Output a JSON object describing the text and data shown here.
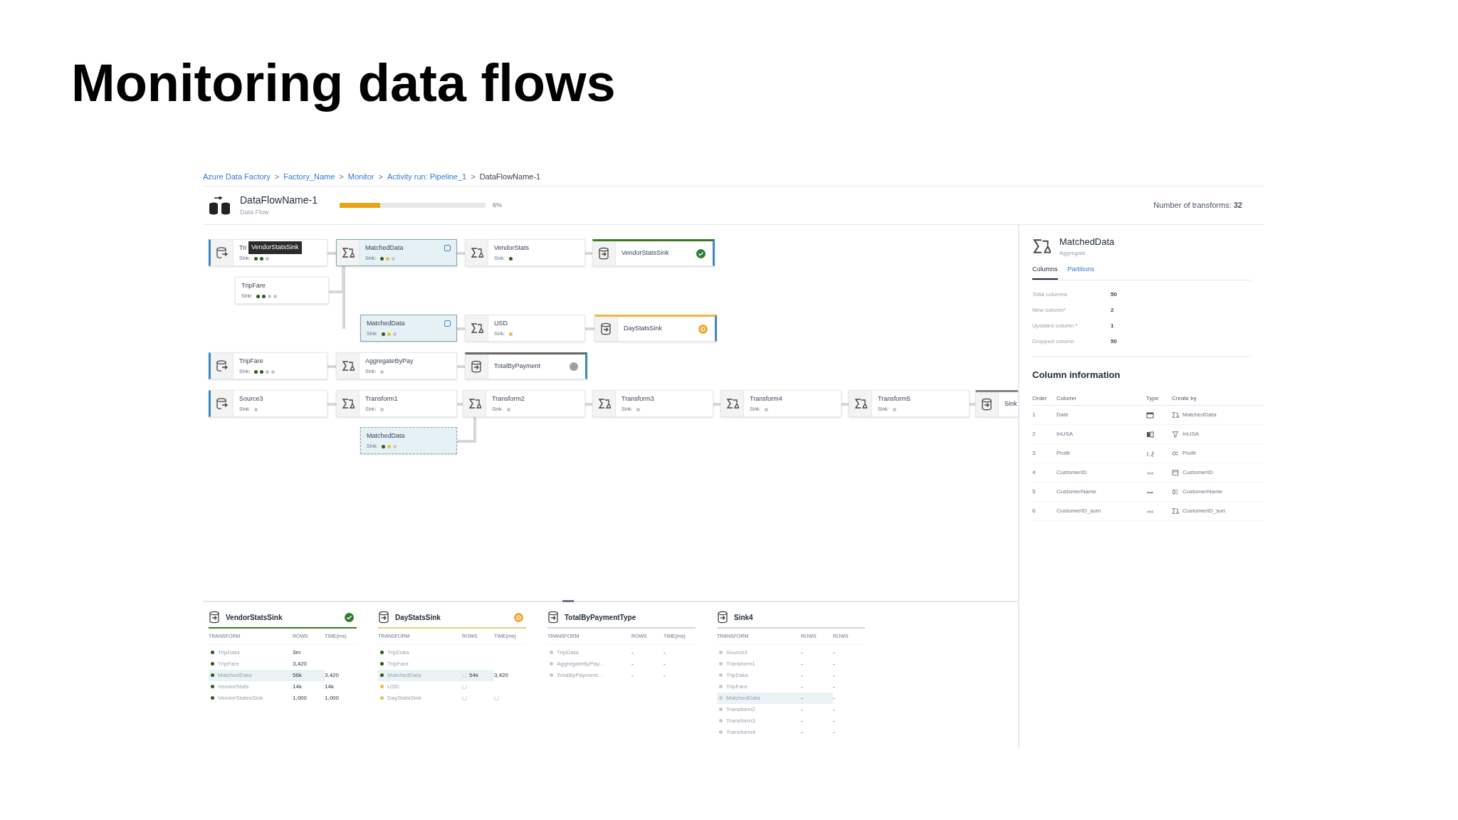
{
  "slide_title": "Monitoring data flows",
  "breadcrumb": [
    {
      "label": "Azure Data Factory",
      "link": true
    },
    {
      "label": "Factory_Name",
      "link": true
    },
    {
      "label": "Monitor",
      "link": true
    },
    {
      "label": "Activity run: Pipeline_1",
      "link": true
    },
    {
      "label": "DataFlowName-1",
      "link": false
    }
  ],
  "breadcrumb_separator": ">",
  "header": {
    "title": "DataFlowName-1",
    "subtitle": "Data Flow",
    "progress": {
      "level": 0.28,
      "reading": "6%"
    },
    "transform_count": "Number of transforms: **32**"
  },
  "nodes": [
    {
      "kind": "source",
      "name": "Tri",
      "label": "Sink:",
      "selected": false,
      "sinks": [
        {
          "color": "#2d5a1b"
        },
        {
          "color": "#2d5a1b"
        },
        {
          "color": "#c8c8c8"
        }
      ]
    },
    {
      "kind": "transform",
      "name": "MatchedData",
      "label": "Sink:",
      "selected": true,
      "cached": true,
      "sinks": [
        {
          "color": "#2d5a1b"
        },
        {
          "color": "#e3c23b"
        },
        {
          "color": "#c8c8c8"
        }
      ]
    },
    {
      "kind": "transform",
      "name": "VendorStats",
      "label": "Sink:",
      "selected": false,
      "sinks": [
        {
          "color": "#2d5a1b"
        }
      ]
    },
    {
      "kind": "sink",
      "name": "VendorStatsSink",
      "selected": false,
      "succeeded": true,
      "warning": false,
      "queued": false
    },
    {
      "kind": "stream",
      "name": "TripFare",
      "label": "Sink:",
      "selected": false,
      "sinks": [
        {
          "color": "#2d5a1b"
        },
        {
          "color": "#2d5a1b"
        },
        {
          "color": "#c8c8c8"
        },
        {
          "color": "#c8c8c8"
        }
      ]
    },
    {
      "kind": "stream",
      "name": "MatchedData",
      "label": "Sink:",
      "selected": true,
      "cached": true,
      "sinks": [
        {
          "color": "#2d5a1b"
        },
        {
          "color": "#e3c23b"
        },
        {
          "color": "#c8c8c8"
        }
      ]
    },
    {
      "kind": "transform",
      "name": "USD",
      "label": "Sink:",
      "selected": false,
      "sinks": [
        {
          "color": "#e3c23b"
        }
      ]
    },
    {
      "kind": "sink",
      "name": "DayStatsSink",
      "selected": false,
      "succeeded": false,
      "warning": true,
      "queued": false
    },
    {
      "kind": "source",
      "name": "TripFare",
      "label": "Sink:",
      "selected": false,
      "sinks": [
        {
          "color": "#2d5a1b"
        },
        {
          "color": "#2d5a1b"
        },
        {
          "color": "#c8c8c8"
        },
        {
          "color": "#c8c8c8"
        }
      ]
    },
    {
      "kind": "transform",
      "name": "AggregateByPay",
      "label": "Sink:",
      "selected": false,
      "sinks": [
        {
          "color": "#c8c8c8"
        }
      ]
    },
    {
      "kind": "sink",
      "name": "TotalByPayment",
      "selected": false,
      "succeeded": false,
      "warning": false,
      "queued": true
    },
    {
      "kind": "source",
      "name": "Source3",
      "label": "Sink:",
      "selected": false,
      "sinks": [
        {
          "color": "#c8c8c8"
        }
      ]
    },
    {
      "kind": "transform",
      "name": "Transform1",
      "label": "Sink:",
      "selected": false,
      "sinks": [
        {
          "color": "#c8c8c8"
        }
      ]
    },
    {
      "kind": "transform",
      "name": "Transform2",
      "label": "Sink:",
      "selected": false,
      "sinks": [
        {
          "color": "#c8c8c8"
        }
      ]
    },
    {
      "kind": "transform",
      "name": "Transform3",
      "label": "Sink:",
      "selected": false,
      "sinks": [
        {
          "color": "#c8c8c8"
        }
      ]
    },
    {
      "kind": "transform",
      "name": "Transform4",
      "label": "Sink:",
      "selected": false,
      "sinks": [
        {
          "color": "#c8c8c8"
        }
      ]
    },
    {
      "kind": "transform",
      "name": "Transform5",
      "label": "Sink:",
      "selected": false,
      "sinks": [
        {
          "color": "#c8c8c8"
        }
      ]
    },
    {
      "kind": "sink",
      "name": "Sink",
      "selected": false,
      "succeeded": false,
      "warning": false,
      "queued": false
    },
    {
      "kind": "stream",
      "name": "MatchedData",
      "label": "Sink:",
      "selected": true,
      "cached": false,
      "sinks": [
        {
          "color": "#2d5a1b"
        },
        {
          "color": "#e3c23b"
        },
        {
          "color": "#c8c8c8"
        }
      ]
    }
  ],
  "tooltip": "VendorStatsSink",
  "details": {
    "title": "MatchedData",
    "subtitle": "Aggregate",
    "tabs": [
      {
        "label": "Columns",
        "selected": true
      },
      {
        "label": "Partitions",
        "selected": false
      }
    ],
    "stats": [
      {
        "label": "Total columns",
        "value": "50"
      },
      {
        "label": "New column*",
        "value": "2"
      },
      {
        "label": "Updated column *",
        "value": "1"
      },
      {
        "label": "Dropped column",
        "value": "50"
      }
    ],
    "column_info_title": "Column information",
    "columns": [
      "Order",
      "Column",
      "Type",
      "Create by"
    ],
    "rows": [
      {
        "order": "1",
        "column": "Date",
        "created_by": "MatchedData"
      },
      {
        "order": "2",
        "column": "InUSA",
        "created_by": "InUSA"
      },
      {
        "order": "3",
        "column": "Profit",
        "created_by": "Profit"
      },
      {
        "order": "4",
        "column": "CustomerID",
        "created_by": "CustomerID"
      },
      {
        "order": "5",
        "column": "CustomerName",
        "created_by": "CustomerName"
      },
      {
        "order": "6",
        "column": "CustomerID_sum",
        "created_by": "CustomerID_sun"
      }
    ]
  },
  "sink_cards": [
    {
      "title": "VendorStatsSink",
      "succeeded": true,
      "warning": false,
      "columns": [
        "TRANSFORM",
        "ROWS",
        "TIME(ms)"
      ],
      "rows": [
        {
          "name": "TripData",
          "color": "#2d5a1b",
          "rows": "3m",
          "time": "",
          "rows_loading": false,
          "time_loading": false,
          "selected": false
        },
        {
          "name": "TripFare",
          "color": "#2d5a1b",
          "rows": "3,420",
          "time": "",
          "rows_loading": false,
          "time_loading": false,
          "selected": false
        },
        {
          "name": "MatchedData",
          "color": "#2d5a1b",
          "rows": "56k",
          "time": "3,420",
          "rows_loading": false,
          "time_loading": false,
          "selected": true
        },
        {
          "name": "VendorStats",
          "color": "#2d5a1b",
          "rows": "14k",
          "time": "14k",
          "rows_loading": false,
          "time_loading": false,
          "selected": false
        },
        {
          "name": "VendorStatesSink",
          "color": "#2d5a1b",
          "rows": "1,000",
          "time": "1,000",
          "rows_loading": false,
          "time_loading": false,
          "selected": false
        }
      ]
    },
    {
      "title": "DayStatsSink",
      "succeeded": false,
      "warning": true,
      "columns": [
        "TRANSFORM",
        "ROWS",
        "TIME(ms)"
      ],
      "rows": [
        {
          "name": "TripData",
          "color": "#2d5a1b",
          "rows": "",
          "time": "",
          "rows_loading": false,
          "time_loading": false,
          "selected": false
        },
        {
          "name": "TripFare",
          "color": "#2d5a1b",
          "rows": "",
          "time": "",
          "rows_loading": false,
          "time_loading": false,
          "selected": false
        },
        {
          "name": "MatchedData",
          "color": "#2d5a1b",
          "rows": "54k",
          "time": "3,420",
          "rows_loading": true,
          "time_loading": false,
          "selected": true
        },
        {
          "name": "USD",
          "color": "#e3c23b",
          "rows": "",
          "time": "",
          "rows_loading": true,
          "time_loading": false,
          "selected": false
        },
        {
          "name": "DayStatsSink",
          "color": "#e3c23b",
          "rows": "",
          "time": "",
          "rows_loading": true,
          "time_loading": true,
          "selected": false
        }
      ]
    },
    {
      "title": "TotalByPaymentType",
      "succeeded": false,
      "warning": false,
      "columns": [
        "TRANSFORM",
        "ROWS",
        "TIME(ms)"
      ],
      "rows": [
        {
          "name": "TripData",
          "color": "#c8c8c8",
          "rows": "-",
          "time": "-",
          "rows_loading": false,
          "time_loading": false,
          "selected": false
        },
        {
          "name": "AggregateByPay...",
          "color": "#c8c8c8",
          "rows": "-",
          "time": "-",
          "rows_loading": false,
          "time_loading": false,
          "selected": false
        },
        {
          "name": "TotalByPayment...",
          "color": "#c8c8c8",
          "rows": "-",
          "time": "-",
          "rows_loading": false,
          "time_loading": false,
          "selected": false
        }
      ]
    },
    {
      "title": "Sink4",
      "succeeded": false,
      "warning": false,
      "columns": [
        "TRANSFORM",
        "ROWS",
        "ROWS"
      ],
      "rows": [
        {
          "name": "Source3",
          "color": "#c8c8c8",
          "rows": "-",
          "time": "-",
          "rows_loading": false,
          "time_loading": false,
          "selected": false
        },
        {
          "name": "Transform1",
          "color": "#c8c8c8",
          "rows": "-",
          "time": "-",
          "rows_loading": false,
          "time_loading": false,
          "selected": false
        },
        {
          "name": "TripData",
          "color": "#c8c8c8",
          "rows": "-",
          "time": "-",
          "rows_loading": false,
          "time_loading": false,
          "selected": false
        },
        {
          "name": "TripFare",
          "color": "#c8c8c8",
          "rows": "-",
          "time": "-",
          "rows_loading": false,
          "time_loading": false,
          "selected": false
        },
        {
          "name": "MatchedData",
          "color": "#c8c8c8",
          "rows": "-",
          "time": "-",
          "rows_loading": false,
          "time_loading": false,
          "selected": true
        },
        {
          "name": "Transform2",
          "color": "#c8c8c8",
          "rows": "-",
          "time": "-",
          "rows_loading": false,
          "time_loading": false,
          "selected": false
        },
        {
          "name": "Transform3",
          "color": "#c8c8c8",
          "rows": "-",
          "time": "-",
          "rows_loading": false,
          "time_loading": false,
          "selected": false
        },
        {
          "name": "Transform4",
          "color": "#c8c8c8",
          "rows": "-",
          "time": "-",
          "rows_loading": false,
          "time_loading": false,
          "selected": false
        }
      ]
    }
  ]
}
